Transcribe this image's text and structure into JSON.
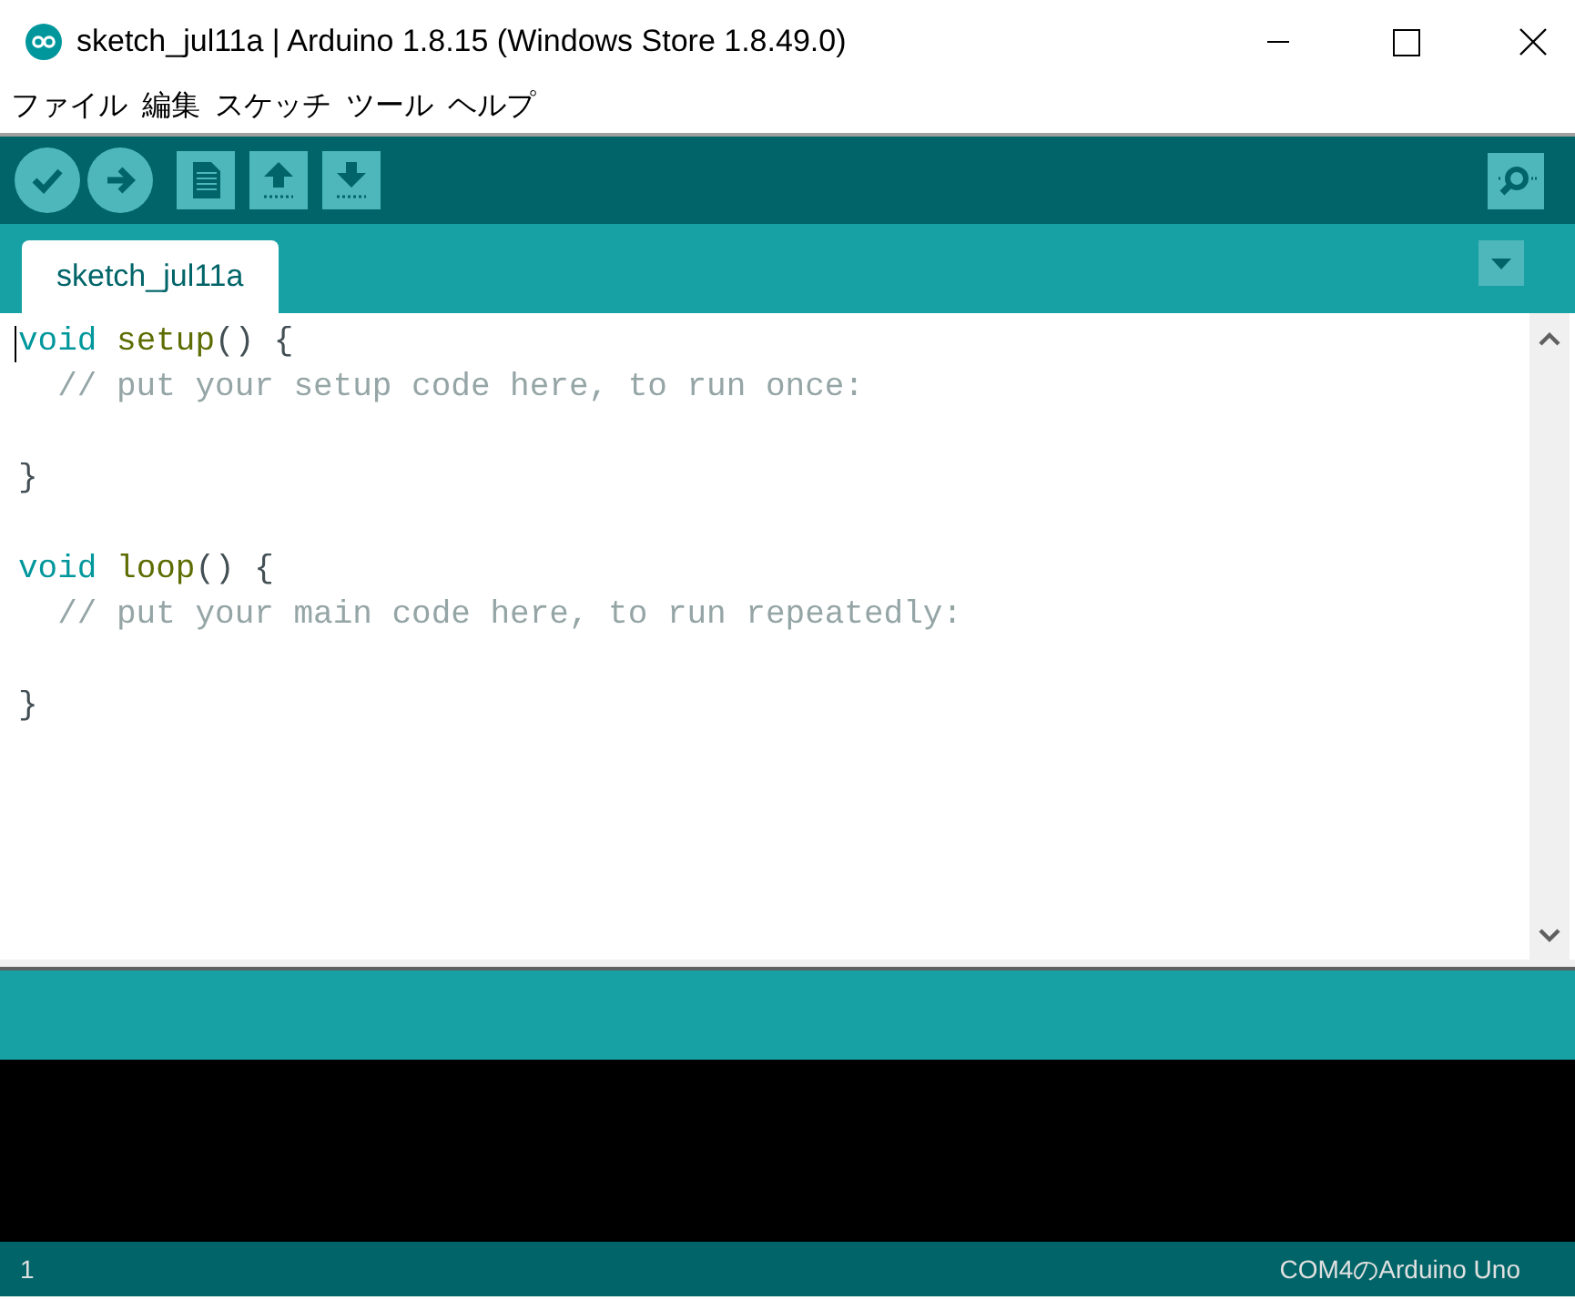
{
  "window": {
    "title": "sketch_jul11a | Arduino 1.8.15 (Windows Store 1.8.49.0)"
  },
  "menu": [
    "ファイル",
    "編集",
    "スケッチ",
    "ツール",
    "ヘルプ"
  ],
  "tabs": [
    {
      "label": "sketch_jul11a",
      "selected": true
    }
  ],
  "code_lines": [
    {
      "kind": "code",
      "tokens": [
        {
          "kind": "type",
          "text": "void"
        },
        {
          "kind": "function",
          "text": " setup"
        },
        {
          "kind": "plain",
          "text": "() {"
        }
      ]
    },
    {
      "kind": "code",
      "tokens": [
        {
          "kind": "comment",
          "text": "  // put your setup code here, to run once:"
        }
      ]
    },
    {
      "kind": "blank"
    },
    {
      "kind": "code",
      "tokens": [
        {
          "kind": "plain",
          "text": "}"
        }
      ]
    },
    {
      "kind": "blank"
    },
    {
      "kind": "code",
      "tokens": [
        {
          "kind": "type",
          "text": "void"
        },
        {
          "kind": "function",
          "text": " loop"
        },
        {
          "kind": "plain",
          "text": "() {"
        }
      ]
    },
    {
      "kind": "code",
      "tokens": [
        {
          "kind": "comment",
          "text": "  // put your main code here, to run repeatedly:"
        }
      ]
    },
    {
      "kind": "blank"
    },
    {
      "kind": "code",
      "tokens": [
        {
          "kind": "plain",
          "text": "}"
        }
      ]
    }
  ],
  "status_bar": {
    "line": "1",
    "board": "COM4のArduino Uno"
  }
}
